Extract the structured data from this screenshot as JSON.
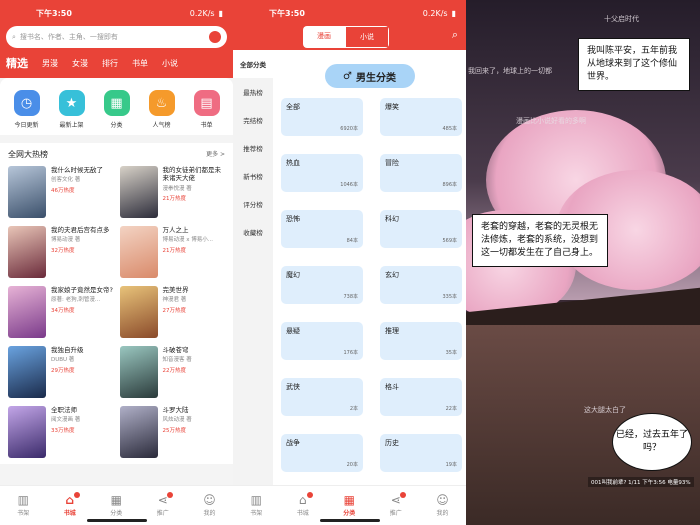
{
  "status": {
    "time": "下午3:50",
    "speed1": "0.2K/s",
    "speed2": "0.2K/s",
    "battery": "100"
  },
  "p1": {
    "search_placeholder": "搜书名、作者、主角、一搜即有",
    "tabs": [
      "精选",
      "男漫",
      "女漫",
      "排行",
      "书单",
      "小说"
    ],
    "quick": [
      {
        "label": "今日更新",
        "icon": "clock-icon",
        "color": "#4a8ee8"
      },
      {
        "label": "最新上架",
        "icon": "star-icon",
        "color": "#37c0d9"
      },
      {
        "label": "分类",
        "icon": "grid-icon",
        "color": "#37c98a"
      },
      {
        "label": "人气榜",
        "icon": "flame-icon",
        "color": "#f59a2b"
      },
      {
        "label": "书单",
        "icon": "book-icon",
        "color": "#ef6c82"
      }
    ],
    "hot_title": "全网大热榜",
    "more": "更多 >",
    "books": [
      {
        "title": "我什么时候无敌了",
        "author": "创客文化 著",
        "heat": "46万热度",
        "c1": "#3a4f6a",
        "c2": "#b7c6d9"
      },
      {
        "title": "我的女徒弟们都是未来诸天大佬",
        "author": "漫拳悦漫 著",
        "heat": "21万热度",
        "c1": "#2c2c3a",
        "c2": "#d8d2c8"
      },
      {
        "title": "我的夫君后宫有点多",
        "author": "博易动漫 著",
        "heat": "32万热度",
        "c1": "#6a2a3a",
        "c2": "#e9c6b8"
      },
      {
        "title": "万人之上",
        "author": "博易动漫 x 博易小...",
        "heat": "21万热度",
        "c1": "#d98a6a",
        "c2": "#f3d3c3"
      },
      {
        "title": "我家娘子竟然是女帝?",
        "author": "原著: 老狗,刺管漫...",
        "heat": "34万热度",
        "c1": "#7a3a8a",
        "c2": "#e7b3d6"
      },
      {
        "title": "完美世界",
        "author": "神漫君 著",
        "heat": "27万热度",
        "c1": "#8a4a2a",
        "c2": "#e8c37a"
      },
      {
        "title": "我独自升级",
        "author": "DUBU 著",
        "heat": "29万热度",
        "c1": "#1a2a4a",
        "c2": "#6aa3e0"
      },
      {
        "title": "斗破苍穹",
        "author": "知音漫客 著",
        "heat": "22万热度",
        "c1": "#2a3a3a",
        "c2": "#9ac7c0"
      },
      {
        "title": "全职法师",
        "author": "阅文漫画 著",
        "heat": "33万热度",
        "c1": "#3a2a6a",
        "c2": "#c3a6e8"
      },
      {
        "title": "斗罗大陆",
        "author": "风炫动漫 著",
        "heat": "25万热度",
        "c1": "#2a2a3a",
        "c2": "#b0b0c8"
      }
    ]
  },
  "nav": [
    "书架",
    "书城",
    "分类",
    "推广",
    "我的"
  ],
  "p2": {
    "toggle": [
      "漫画",
      "小说"
    ],
    "side": [
      "全部分类",
      "最热榜",
      "完结榜",
      "推荐榜",
      "新书榜",
      "评分榜",
      "收藏榜"
    ],
    "title": "男生分类",
    "cats": [
      {
        "name": "全部",
        "count": "6920本"
      },
      {
        "name": "爆笑",
        "count": "485本"
      },
      {
        "name": "热血",
        "count": "1046本"
      },
      {
        "name": "冒险",
        "count": "896本"
      },
      {
        "name": "恐怖",
        "count": "84本"
      },
      {
        "name": "科幻",
        "count": "569本"
      },
      {
        "name": "魔幻",
        "count": "738本"
      },
      {
        "name": "玄幻",
        "count": "335本"
      },
      {
        "name": "悬疑",
        "count": "176本"
      },
      {
        "name": "推理",
        "count": "35本"
      },
      {
        "name": "武侠",
        "count": "2本"
      },
      {
        "name": "格斗",
        "count": "22本"
      },
      {
        "name": "战争",
        "count": "20本"
      },
      {
        "name": "历史",
        "count": "19本"
      }
    ]
  },
  "p3": {
    "top_text": "十父启时代",
    "bubble1": "我叫陈平安，五年前我从地球来到了这个修仙世界。",
    "bubble2": "老套的穿越，老套的无灵根无法修炼，老套的系统，没想到这一切都发生在了自己身上。",
    "bubble3": "已经，过去五年了吗？",
    "ovl1": "我回来了，地球上的一切都",
    "ovl2": "漫画比小说好看的多啊",
    "ovl3": "这大腿太白了",
    "bottom": "001叫我前辈? 1/11 下午3:56 电量93%"
  }
}
